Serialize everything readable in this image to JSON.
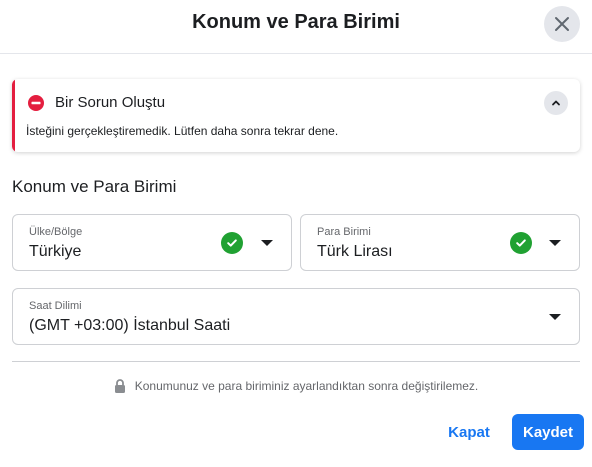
{
  "dialog": {
    "title": "Konum ve Para Birimi",
    "close_icon": "close-icon"
  },
  "alert": {
    "icon": "error-icon",
    "title": "Bir Sorun Oluştu",
    "message": "İsteğini gerçekleştiremedik. Lütfen daha sonra tekrar dene.",
    "collapse_icon": "chevron-up-icon",
    "accent_color": "#e41e3f"
  },
  "section": {
    "title": "Konum ve Para Birimi"
  },
  "fields": {
    "country": {
      "label": "Ülke/Bölge",
      "value": "Türkiye",
      "status_icon": "check-circle-icon",
      "dropdown_icon": "caret-down-icon"
    },
    "currency": {
      "label": "Para Birimi",
      "value": "Türk Lirası",
      "status_icon": "check-circle-icon",
      "dropdown_icon": "caret-down-icon"
    },
    "timezone": {
      "label": "Saat Dilimi",
      "value": "(GMT +03:00) İstanbul Saati",
      "dropdown_icon": "caret-down-icon"
    }
  },
  "note": {
    "icon": "lock-icon",
    "text": "Konumunuz ve para biriminiz ayarlandıktan sonra değiştirilemez."
  },
  "footer": {
    "close_label": "Kapat",
    "save_label": "Kaydet"
  },
  "colors": {
    "primary": "#1877f2",
    "success": "#20a132",
    "error": "#e41e3f"
  }
}
